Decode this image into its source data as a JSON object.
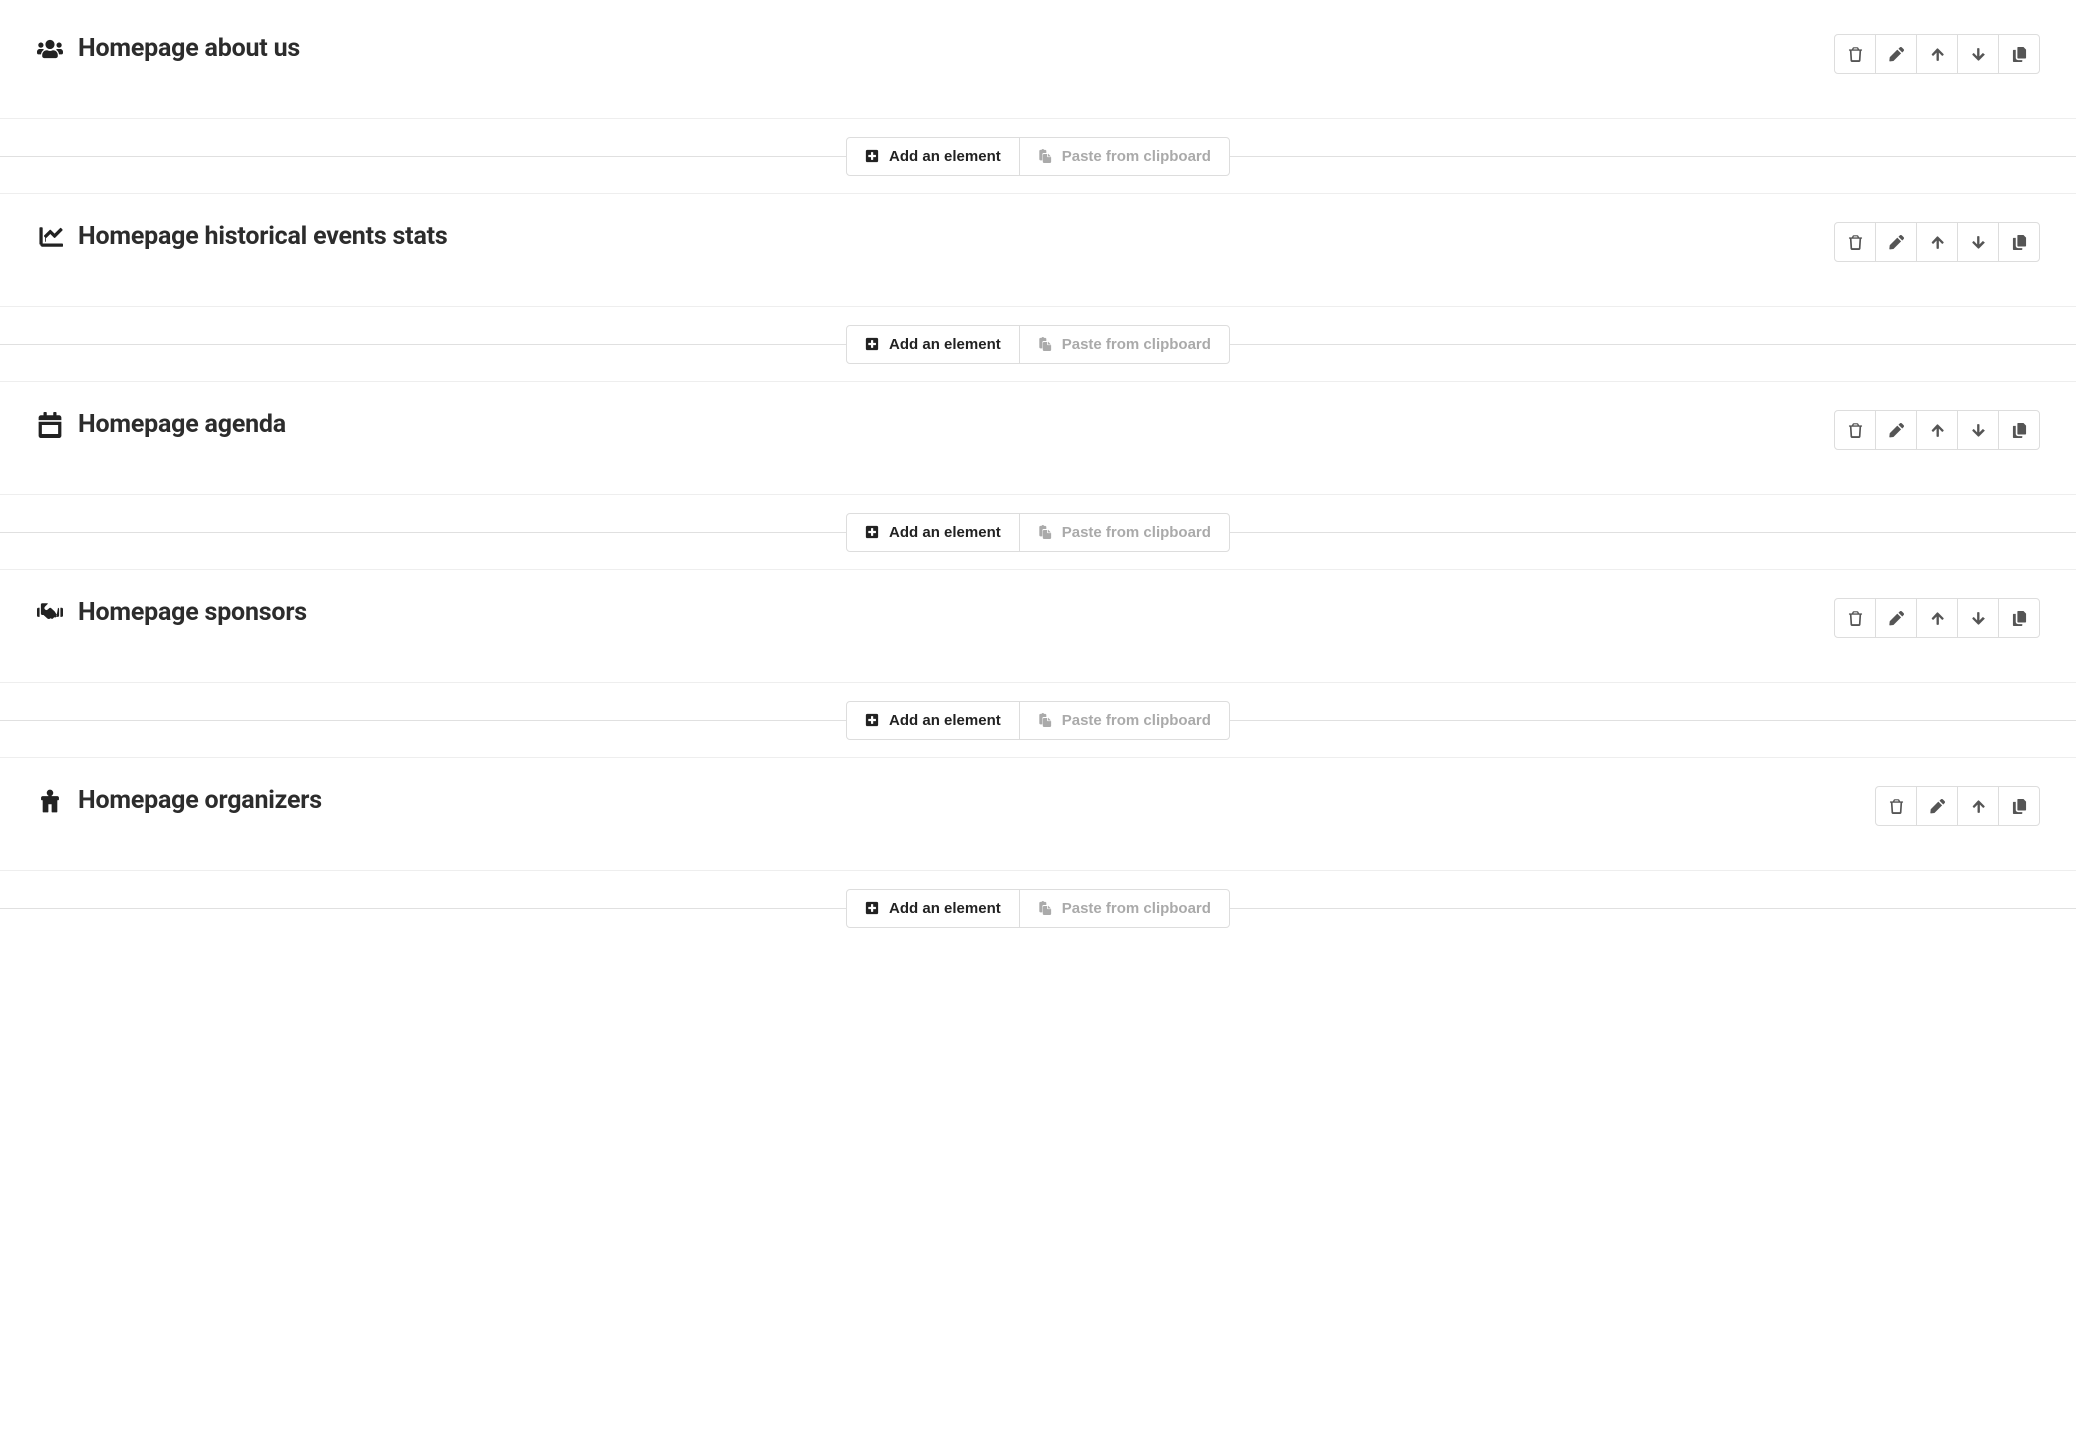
{
  "labels": {
    "add_element": "Add an element",
    "paste_clipboard": "Paste from clipboard"
  },
  "blocks": [
    {
      "icon": "users",
      "title": "Homepage about us",
      "actions": [
        "trash",
        "pencil",
        "up",
        "down",
        "copy"
      ]
    },
    {
      "icon": "chart",
      "title": "Homepage historical events stats",
      "actions": [
        "trash",
        "pencil",
        "up",
        "down",
        "copy"
      ]
    },
    {
      "icon": "calendar",
      "title": "Homepage agenda",
      "actions": [
        "trash",
        "pencil",
        "up",
        "down",
        "copy"
      ]
    },
    {
      "icon": "handshake",
      "title": "Homepage sponsors",
      "actions": [
        "trash",
        "pencil",
        "up",
        "down",
        "copy"
      ]
    },
    {
      "icon": "people",
      "title": "Homepage organizers",
      "actions": [
        "trash",
        "pencil",
        "up",
        "copy"
      ]
    }
  ]
}
